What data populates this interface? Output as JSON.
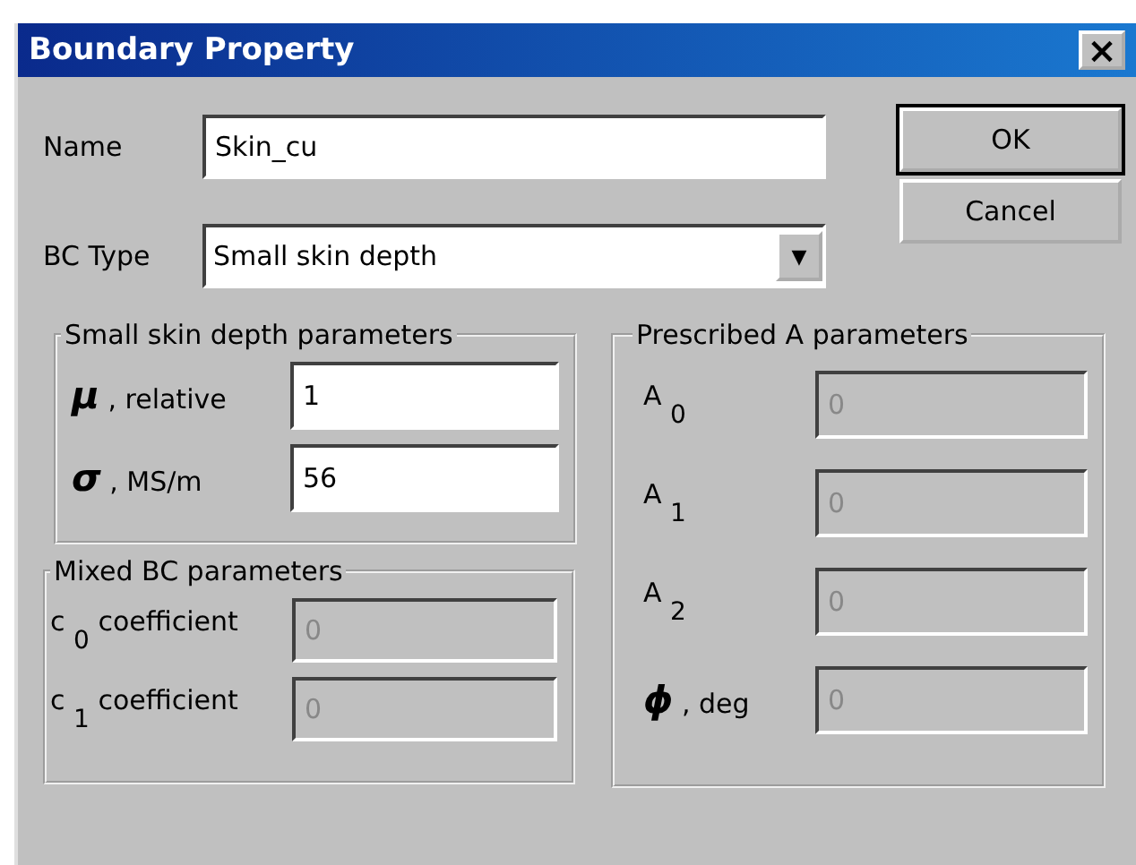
{
  "window": {
    "title": "Boundary Property",
    "close": "×"
  },
  "name": {
    "label": "Name",
    "value": "Skin_cu"
  },
  "bc_type": {
    "label": "BC Type",
    "value": "Small skin depth",
    "arrow": "▼"
  },
  "buttons": [
    {
      "label": "OK",
      "default": true
    },
    {
      "label": "Cancel",
      "default": false
    }
  ],
  "groups": [
    {
      "title": "Small skin depth parameters",
      "fields": [
        {
          "label": "**μ** , relative",
          "value": "1",
          "disabled": false
        },
        {
          "label": "**σ** , MS/m",
          "value": "56",
          "disabled": false
        }
      ]
    },
    {
      "title": "Mixed BC parameters",
      "fields": [
        {
          "label": "c $_{0}$ coefficient",
          "value": "0",
          "disabled": true
        },
        {
          "label": "c $_{1}$ coefficient",
          "value": "0",
          "disabled": true
        }
      ]
    },
    {
      "title": "Prescribed A parameters",
      "fields": [
        {
          "label": "A $_{0}$",
          "value": "0",
          "disabled": true
        },
        {
          "label": "A $_{1}$",
          "value": "0",
          "disabled": true
        },
        {
          "label": "A $_{2}$",
          "value": "0",
          "disabled": true
        },
        {
          "label": "**ϕ** , deg",
          "value": "0",
          "disabled": true
        }
      ]
    }
  ]
}
